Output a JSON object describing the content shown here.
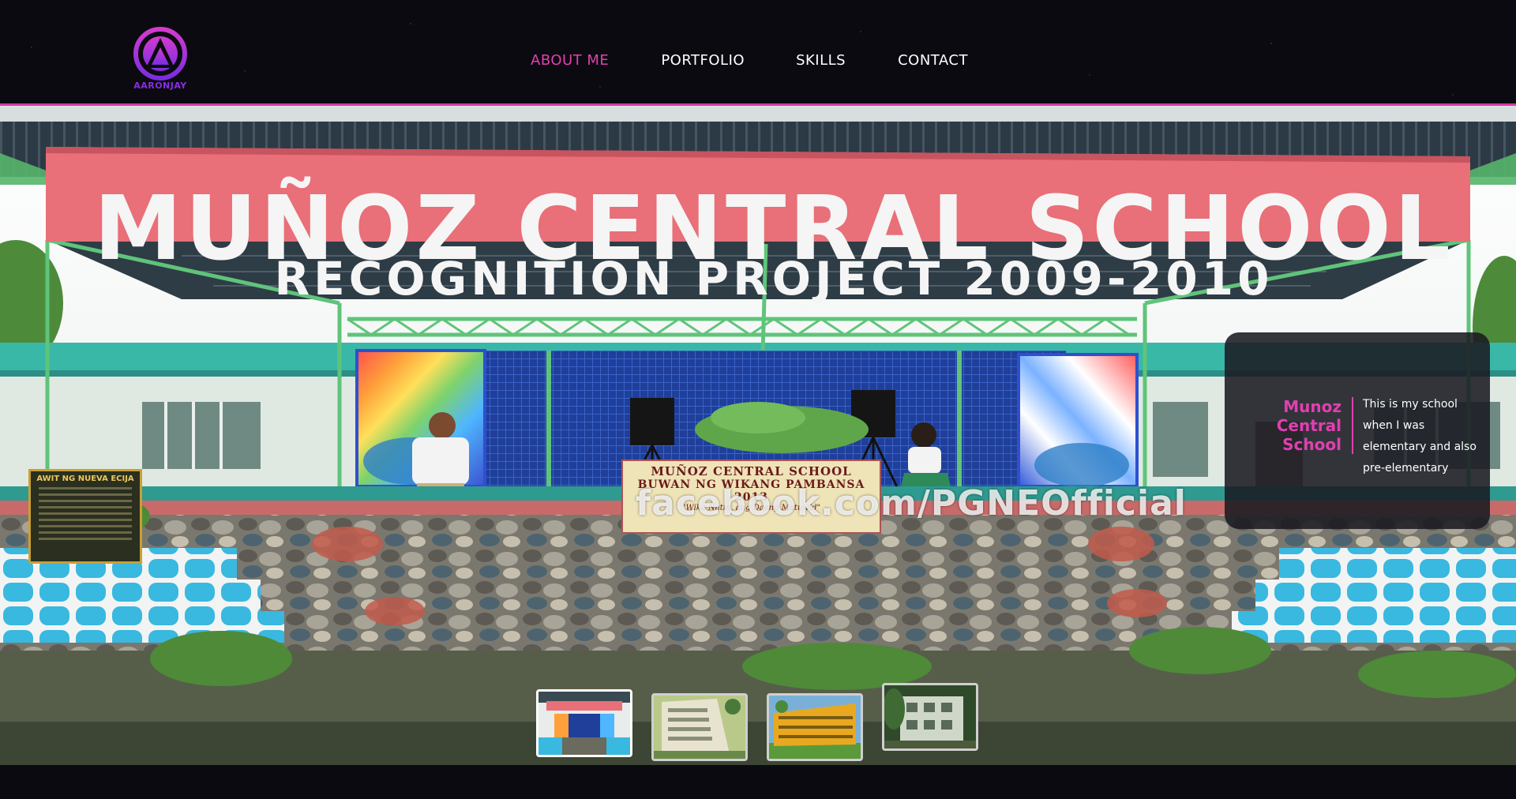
{
  "header": {
    "logo_text": "AARONJAY",
    "nav": [
      {
        "label": "ABOUT ME",
        "active": true
      },
      {
        "label": "PORTFOLIO",
        "active": false
      },
      {
        "label": "SKILLS",
        "active": false
      },
      {
        "label": "CONTACT",
        "active": false
      }
    ]
  },
  "hero": {
    "banner_title": "MUÑOZ CENTRAL SCHOOL",
    "banner_subtitle": "RECOGNITION PROJECT 2009-2010",
    "stage_poster": {
      "line1": "MUÑOZ CENTRAL SCHOOL",
      "line2": "BUWAN NG WIKANG PAMBANSA 2013",
      "line3": "\"Wika Natin, ang Daang Matuwid\""
    },
    "left_poster_title": "AWIT NG NUEVA ECIJA",
    "watermark": "facebook.com/PGNEOfficial"
  },
  "info_card": {
    "title_lines": [
      "Munoz",
      "Central",
      "School"
    ],
    "text": "This is my school when I was elementary and also pre-elementary"
  },
  "thumbnails": [
    {
      "name": "stage",
      "active": true
    },
    {
      "name": "building-1",
      "active": false
    },
    {
      "name": "building-2",
      "active": false
    },
    {
      "name": "building-3",
      "active": false
    }
  ],
  "colors": {
    "accent": "#e040b0",
    "header_bg": "#0b0a10",
    "logo": "#8a2de0"
  }
}
